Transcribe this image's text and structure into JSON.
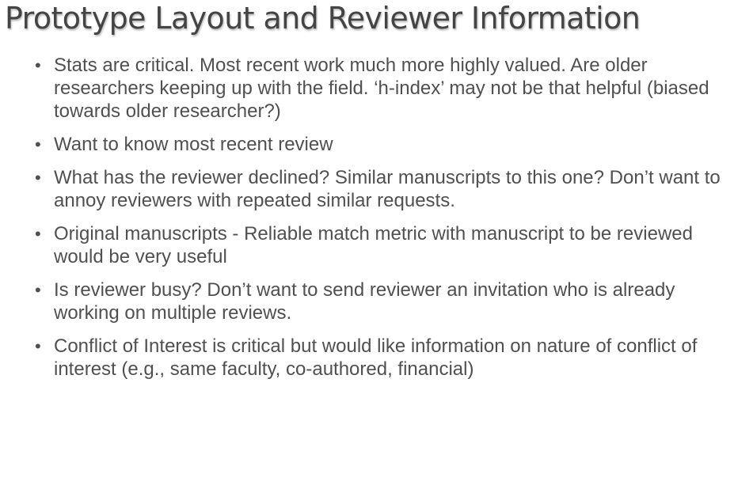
{
  "slide": {
    "title": "Prototype Layout and Reviewer Information",
    "bullet_symbol": "•",
    "bullets": [
      "Stats are critical. Most recent work much more highly valued. Are older researchers keeping up with the field. ‘h-index’ may not be that helpful (biased towards older researcher?)",
      "Want to know most recent review",
      "What has the reviewer declined? Similar manuscripts to this one? Don’t want to annoy reviewers with repeated similar requests.",
      "Original manuscripts - Reliable match metric with manuscript to be reviewed would be very useful",
      "Is reviewer busy? Don’t want to send reviewer an invitation who is already working on multiple reviews.",
      "Conflict of Interest is critical but would like information on nature of conflict of interest (e.g., same faculty, co-authored, financial)"
    ]
  },
  "colors": {
    "title": "#444444",
    "body_text": "#505050",
    "background": "#ffffff"
  }
}
